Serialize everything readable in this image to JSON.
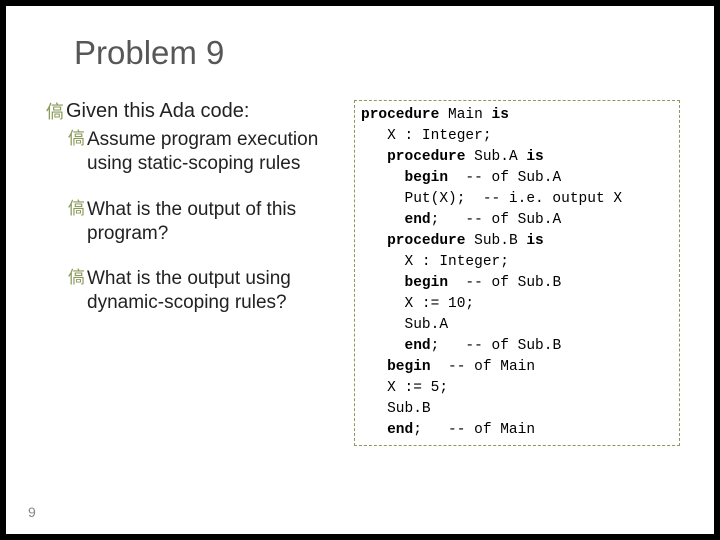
{
  "title": "Problem 9",
  "left": {
    "main": "Given this Ada code:",
    "sub1": "Assume program execution using static-scoping rules",
    "sub2": "What is the output of this program?",
    "sub3": "What is the output using dynamic-scoping rules?"
  },
  "code": {
    "l01a": "procedure",
    "l01b": " Main ",
    "l01c": "is",
    "l02a": "   X : Integer;",
    "l03a": "   ",
    "l03b": "procedure",
    "l03c": " Sub.A ",
    "l03d": "is",
    "l04a": "     ",
    "l04b": "begin",
    "l04c": "  -- of Sub.A",
    "l05a": "     Put(X);  -- i.e. output X",
    "l06a": "     ",
    "l06b": "end",
    "l06c": ";   -- of Sub.A",
    "l07a": "   ",
    "l07b": "procedure",
    "l07c": " Sub.B ",
    "l07d": "is",
    "l08a": "     X : Integer;",
    "l09a": "     ",
    "l09b": "begin",
    "l09c": "  -- of Sub.B",
    "l10a": "     X := 10;",
    "l11a": "     Sub.A",
    "l12a": "     ",
    "l12b": "end",
    "l12c": ";   -- of Sub.B",
    "l13a": "   ",
    "l13b": "begin",
    "l13c": "  -- of Main",
    "l14a": "   X := 5;",
    "l15a": "   Sub.B",
    "l16a": "   ",
    "l16b": "end",
    "l16c": ";   -- of Main"
  },
  "page": "9"
}
